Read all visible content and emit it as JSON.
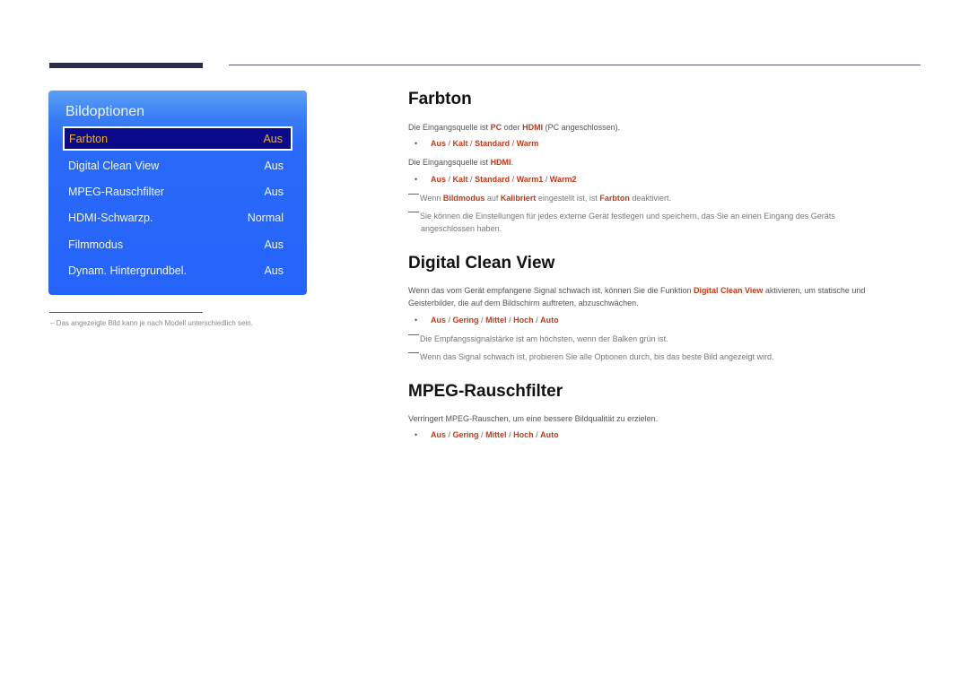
{
  "panel": {
    "title": "Bildoptionen",
    "items": [
      {
        "label": "Farbton",
        "value": "Aus",
        "selected": true
      },
      {
        "label": "Digital Clean View",
        "value": "Aus"
      },
      {
        "label": "MPEG-Rauschfilter",
        "value": "Aus"
      },
      {
        "label": "HDMI-Schwarzp.",
        "value": "Normal"
      },
      {
        "label": "Filmmodus",
        "value": "Aus"
      },
      {
        "label": "Dynam. Hintergrundbel.",
        "value": "Aus"
      }
    ]
  },
  "footnote": "Das angezeigte Bild kann je nach Modell unterschiedlich sein.",
  "colors": {
    "panel_blue": "#2563fa",
    "selected_bg": "#0a0a8a",
    "selected_text": "#f0b020",
    "highlight": "#c43a1a"
  },
  "sections": {
    "farbton": {
      "title": "Farbton",
      "p1": {
        "a": "Die Eingangsquelle ist ",
        "b1": "PC",
        "c": " oder ",
        "b2": "HDMI",
        "d": " (PC angeschlossen)."
      },
      "opts1": [
        "Aus",
        "Kalt",
        "Standard",
        "Warm"
      ],
      "p2": {
        "a": "Die Eingangsquelle ist ",
        "b1": "HDMI",
        "c": "."
      },
      "opts2": [
        "Aus",
        "Kalt",
        "Standard",
        "Warm1",
        "Warm2"
      ],
      "note1": {
        "a": "Wenn ",
        "b1": "Bildmodus",
        "c": " auf ",
        "b2": "Kalibriert",
        "d": " eingestellt ist, ist ",
        "b3": "Farbton",
        "e": " deaktiviert."
      },
      "note2": {
        "line1": "Sie können die Einstellungen für jedes externe Gerät festlegen und speichern, das Sie an einen Eingang des Geräts",
        "line2": "angeschlossen haben."
      }
    },
    "dcv": {
      "title": "Digital Clean View",
      "p1": {
        "a": "Wenn das vom Gerät empfangene Signal schwach ist, können Sie die Funktion ",
        "b1": "Digital Clean View",
        "c": " aktivieren, um statische und Geisterbilder, die auf dem Bildschirm auftreten, abzuschwächen."
      },
      "opts": [
        "Aus",
        "Gering",
        "Mittel",
        "Hoch",
        "Auto"
      ],
      "note1": "Die Empfangssignalstärke ist am höchsten, wenn der Balken grün ist.",
      "note2": "Wenn das Signal schwach ist, probieren Sie alle Optionen durch, bis das beste Bild angezeigt wird."
    },
    "mpeg": {
      "title": "MPEG-Rauschfilter",
      "p1": "Verringert MPEG-Rauschen, um eine bessere Bildqualität zu erzielen.",
      "opts": [
        "Aus",
        "Gering",
        "Mittel",
        "Hoch",
        "Auto"
      ]
    }
  },
  "sep": " / ",
  "bullet": "•"
}
